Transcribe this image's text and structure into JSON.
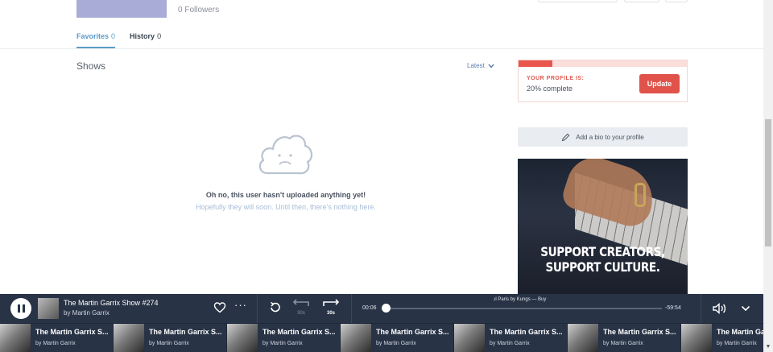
{
  "profile": {
    "followers_text": "0 Followers"
  },
  "tabs": [
    {
      "label": "Favorites",
      "count": "0"
    },
    {
      "label": "History",
      "count": "0"
    }
  ],
  "shows": {
    "title": "Shows",
    "sort_label": "Latest",
    "empty_title": "Oh no, this user hasn't uploaded anything yet!",
    "empty_subtitle": "Hopefully they will soon. Until then, there's nothing here."
  },
  "profile_completion": {
    "label": "YOUR PROFILE IS:",
    "percent_text": "20% complete",
    "percent": 0.2,
    "button": "Update"
  },
  "bio_button": "Add a bio to your profile",
  "ad": {
    "line1": "SUPPORT CREATORS,",
    "line2": "SUPPORT CULTURE."
  },
  "player": {
    "title": "The Martin Garrix Show #274",
    "artist": "by Martin Garrix",
    "elapsed": "00:06",
    "remaining": "-59:54",
    "now_playing": "Paris by Kungs — Buy",
    "rewind_label": "30s",
    "forward_label": "30s",
    "progress": 0.002
  },
  "queue": [
    {
      "title": "The Martin Garrix S...",
      "artist": "by Martin Garrix"
    },
    {
      "title": "The Martin Garrix S...",
      "artist": "by Martin Garrix"
    },
    {
      "title": "The Martin Garrix S...",
      "artist": "by Martin Garrix"
    },
    {
      "title": "The Martin Garrix S...",
      "artist": "by Martin Garrix"
    },
    {
      "title": "The Martin Garrix S...",
      "artist": "by Martin Garrix"
    },
    {
      "title": "The Martin Garrix S...",
      "artist": "by Martin Garrix"
    },
    {
      "title": "The Martin Garrix S...",
      "artist": "by Martin Garrix"
    }
  ],
  "colors": {
    "accent": "#5c9cc9",
    "update": "#e0524a",
    "player_bg": "#283346"
  }
}
